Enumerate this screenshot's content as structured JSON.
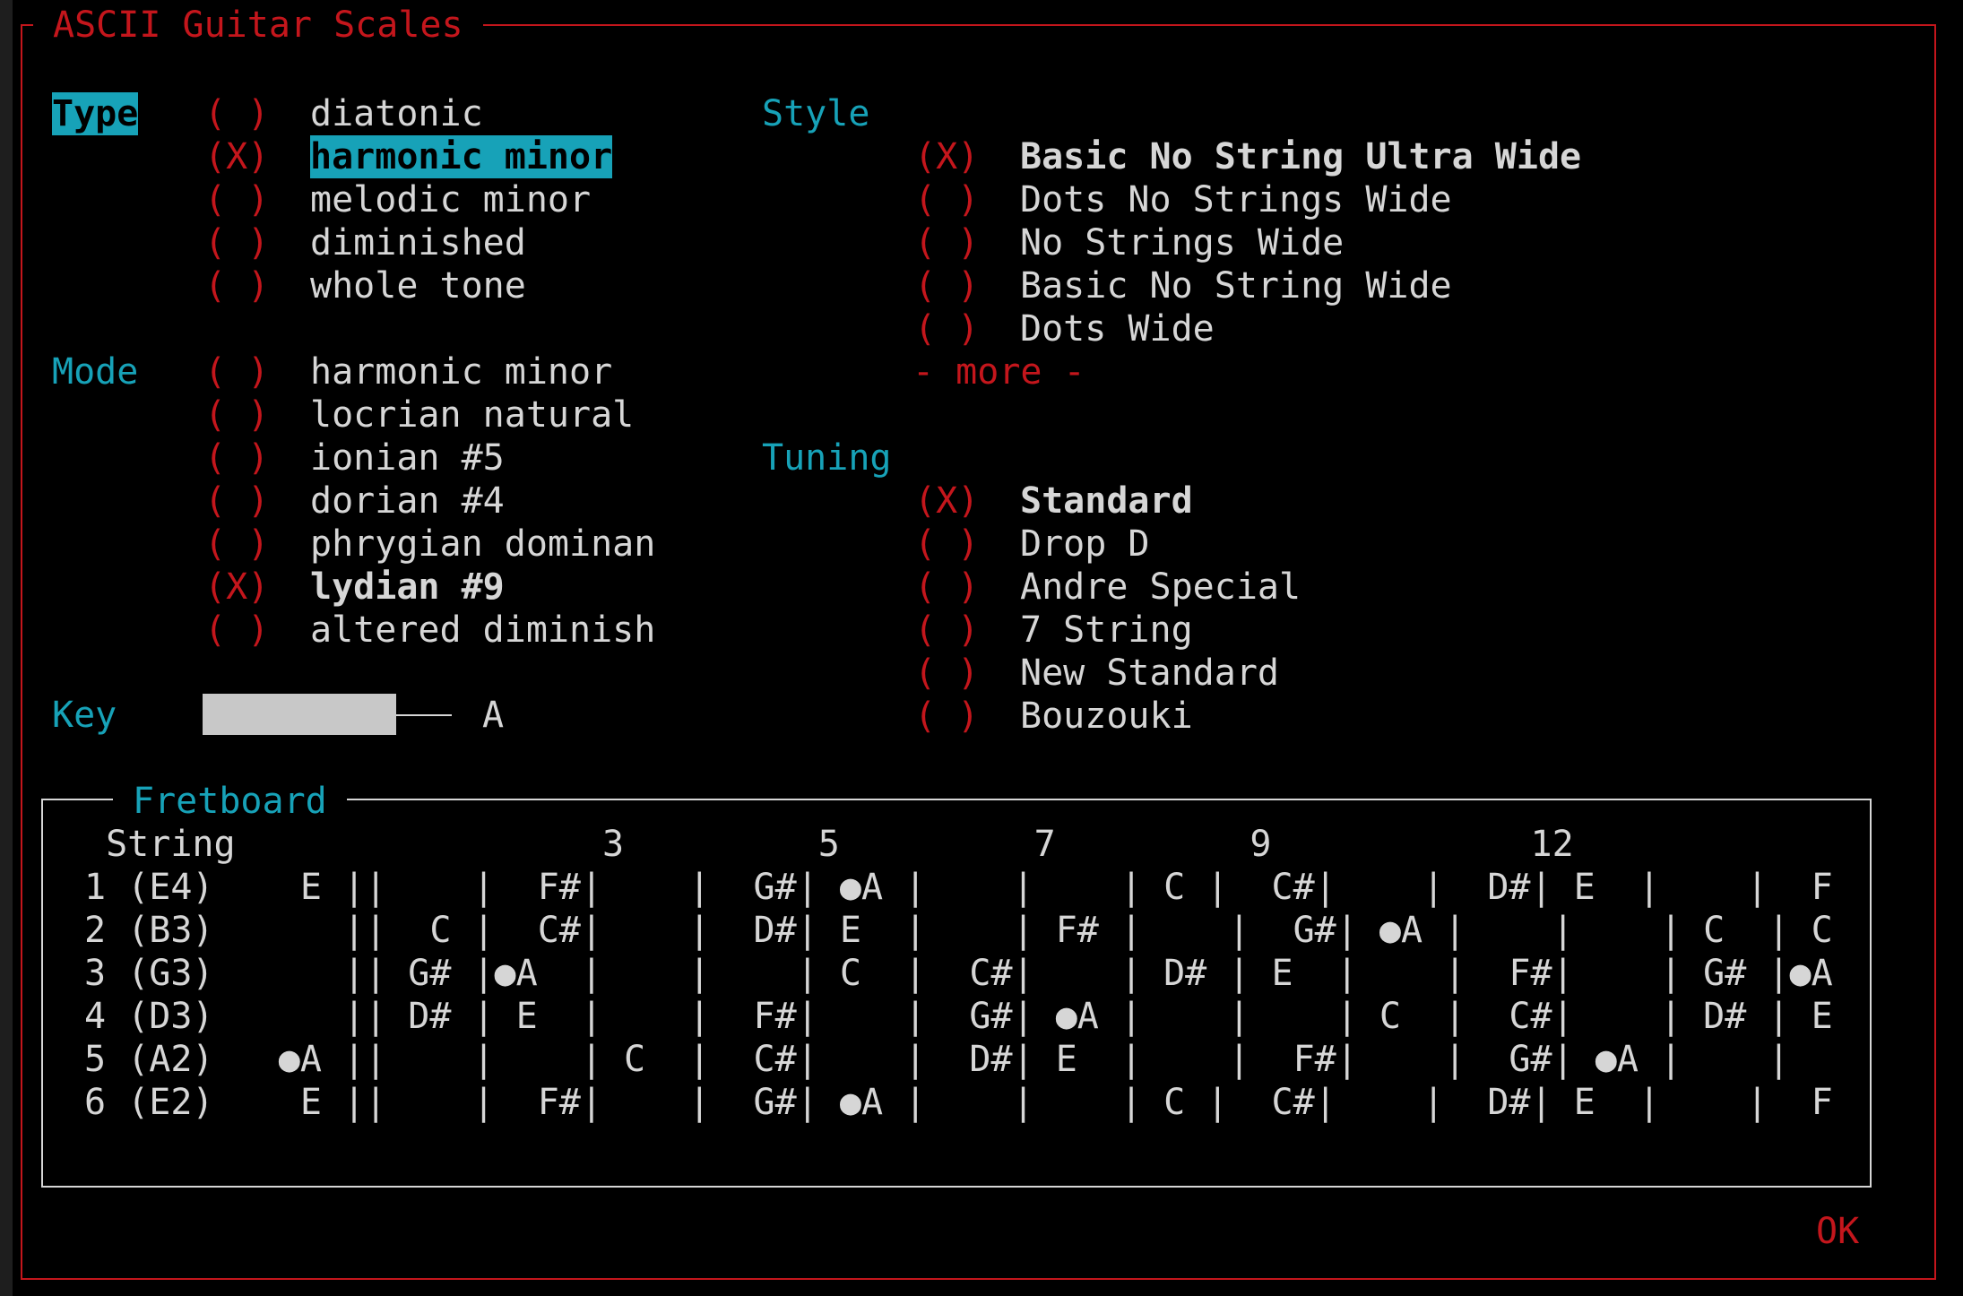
{
  "window_title": "ASCII Guitar Scales",
  "type_section": {
    "label": "Type",
    "items": [
      {
        "mark": "( )",
        "label": "diatonic"
      },
      {
        "mark": "(X)",
        "label": "harmonic minor"
      },
      {
        "mark": "( )",
        "label": "melodic minor"
      },
      {
        "mark": "( )",
        "label": "diminished"
      },
      {
        "mark": "( )",
        "label": "whole tone"
      }
    ]
  },
  "mode_section": {
    "label": "Mode",
    "items": [
      {
        "mark": "( )",
        "label": "harmonic minor"
      },
      {
        "mark": "( )",
        "label": "locrian natural"
      },
      {
        "mark": "( )",
        "label": "ionian #5"
      },
      {
        "mark": "( )",
        "label": "dorian #4"
      },
      {
        "mark": "( )",
        "label": "phrygian dominan"
      },
      {
        "mark": "(X)",
        "label": "lydian #9"
      },
      {
        "mark": "( )",
        "label": "altered diminish"
      }
    ]
  },
  "key_section": {
    "label": "Key",
    "value": "A",
    "slider_fraction": 0.82
  },
  "style_section": {
    "label": "Style",
    "items": [
      {
        "mark": "(X)",
        "label": "Basic No String Ultra Wide"
      },
      {
        "mark": "( )",
        "label": "Dots No Strings Wide"
      },
      {
        "mark": "( )",
        "label": "No Strings Wide"
      },
      {
        "mark": "( )",
        "label": "Basic No String Wide"
      },
      {
        "mark": "( )",
        "label": "Dots Wide"
      }
    ],
    "more_label": "- more -"
  },
  "tuning_section": {
    "label": "Tuning",
    "items": [
      {
        "mark": "(X)",
        "label": "Standard"
      },
      {
        "mark": "( )",
        "label": "Drop D"
      },
      {
        "mark": "( )",
        "label": "Andre Special"
      },
      {
        "mark": "( )",
        "label": "7 String"
      },
      {
        "mark": "( )",
        "label": "New Standard"
      },
      {
        "mark": "( )",
        "label": "Bouzouki"
      }
    ]
  },
  "fretboard": {
    "title": "Fretboard",
    "header": " String                 3         5         7         9            12",
    "rows": [
      "1 (E4)    E ||    |  F#|    |  G#| ●A |    |    | C |  C#|    |  D#| E  |    |  F",
      "2 (B3)      ||  C |  C#|    |  D#| E  |    | F# |    |  G#| ●A |    |    | C  | C",
      "3 (G3)      || G# |●A  |    |    | C  |  C#|    | D# | E  |    |  F#|    | G# |●A",
      "4 (D3)      || D# | E  |    |  F#|    |  G#| ●A |    |    | C  |  C#|    | D# | E",
      "5 (A2)   ●A ||    |    | C  |  C#|    |  D#| E  |    |  F#|    |  G#| ●A |    |",
      "6 (E2)    E ||    |  F#|    |  G#| ●A |    |    | C |  C#|    |  D#| E  |    |  F"
    ]
  },
  "ok_button_label": "OK",
  "colors": {
    "accent_red": "#c4161c",
    "accent_cyan": "#17a2b8",
    "text": "#d6d6d6",
    "background": "#000000"
  }
}
